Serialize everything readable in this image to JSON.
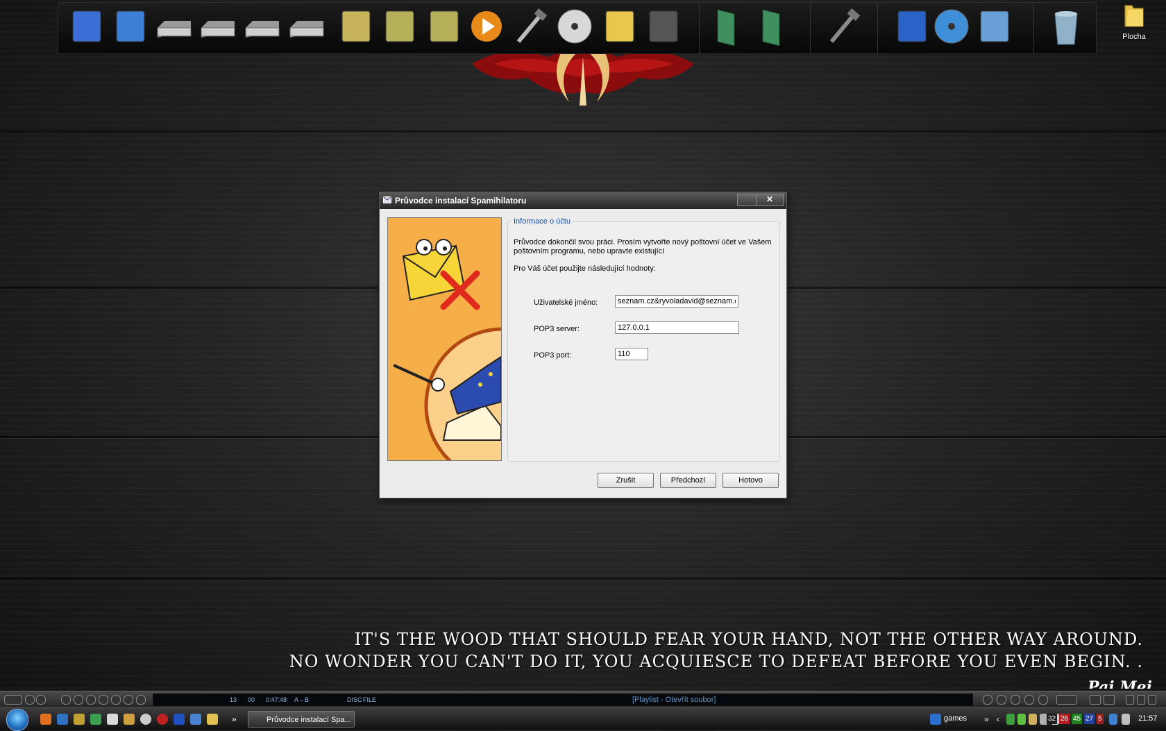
{
  "desktop": {
    "folder_label": "Plocha",
    "quote_line1": "IT'S THE WOOD THAT SHOULD FEAR YOUR HAND, NOT THE OTHER WAY AROUND.",
    "quote_line2": "NO WONDER YOU CAN'T DO IT, YOU ACQUIESCE TO DEFEAT BEFORE YOU EVEN BEGIN. .",
    "signature": "Pai Mei"
  },
  "dock_icons": [
    "computer-icon",
    "control-panel-icon",
    "drive-icon",
    "drive-icon",
    "drive-icon",
    "drive-icon",
    "folder-icon",
    "documents-folder-icon",
    "music-folder-icon",
    "media-player-icon",
    "tools-icon",
    "disc-icon",
    "notes-icon",
    "guitar-icon",
    "recycle-green-icon",
    "recycle-green-icon",
    "hammer-icon",
    "network-icon",
    "globe-monitor-icon",
    "search-monitor-icon",
    "recycle-bin-icon"
  ],
  "dialog": {
    "title": "Průvodce instalací Spamihilatoru",
    "close_glyph": "✕",
    "group_title": "Informace o účtu",
    "intro_text": "Průvodce dokončil svou práci. Prosím vytvořte nový poštovní účet ve Vašem poštovním programu, nebo upravte existující",
    "values_text": "Pro Váš účet použijte následující hodnoty:",
    "username_label": "Uživatelské jméno:",
    "username_value": "seznam.cz&ryvoladavid@seznam.cz",
    "server_label": "POP3 server:",
    "server_value": "127.0.0.1",
    "port_label": "POP3 port:",
    "port_value": "110",
    "cancel_label": "Zrušit",
    "back_label": "Předchozí",
    "finish_label": "Hotovo"
  },
  "player": {
    "track_num": "13",
    "track_sub": "00",
    "time": "0:47:48",
    "ab": "A↔B",
    "disc": "DISC",
    "file": "FILE",
    "playlist_text": "[Playlist - Otevřít soubor]"
  },
  "taskbar": {
    "task_label": "Průvodce instalací Spa...",
    "games_label": "games",
    "tray_numbers": [
      "32",
      "26",
      "45",
      "27",
      "5"
    ],
    "tray_colors": [
      "#1f1f1f",
      "#b02020",
      "#208020",
      "#2040a0",
      "#a02020"
    ],
    "clock": "21:57"
  }
}
